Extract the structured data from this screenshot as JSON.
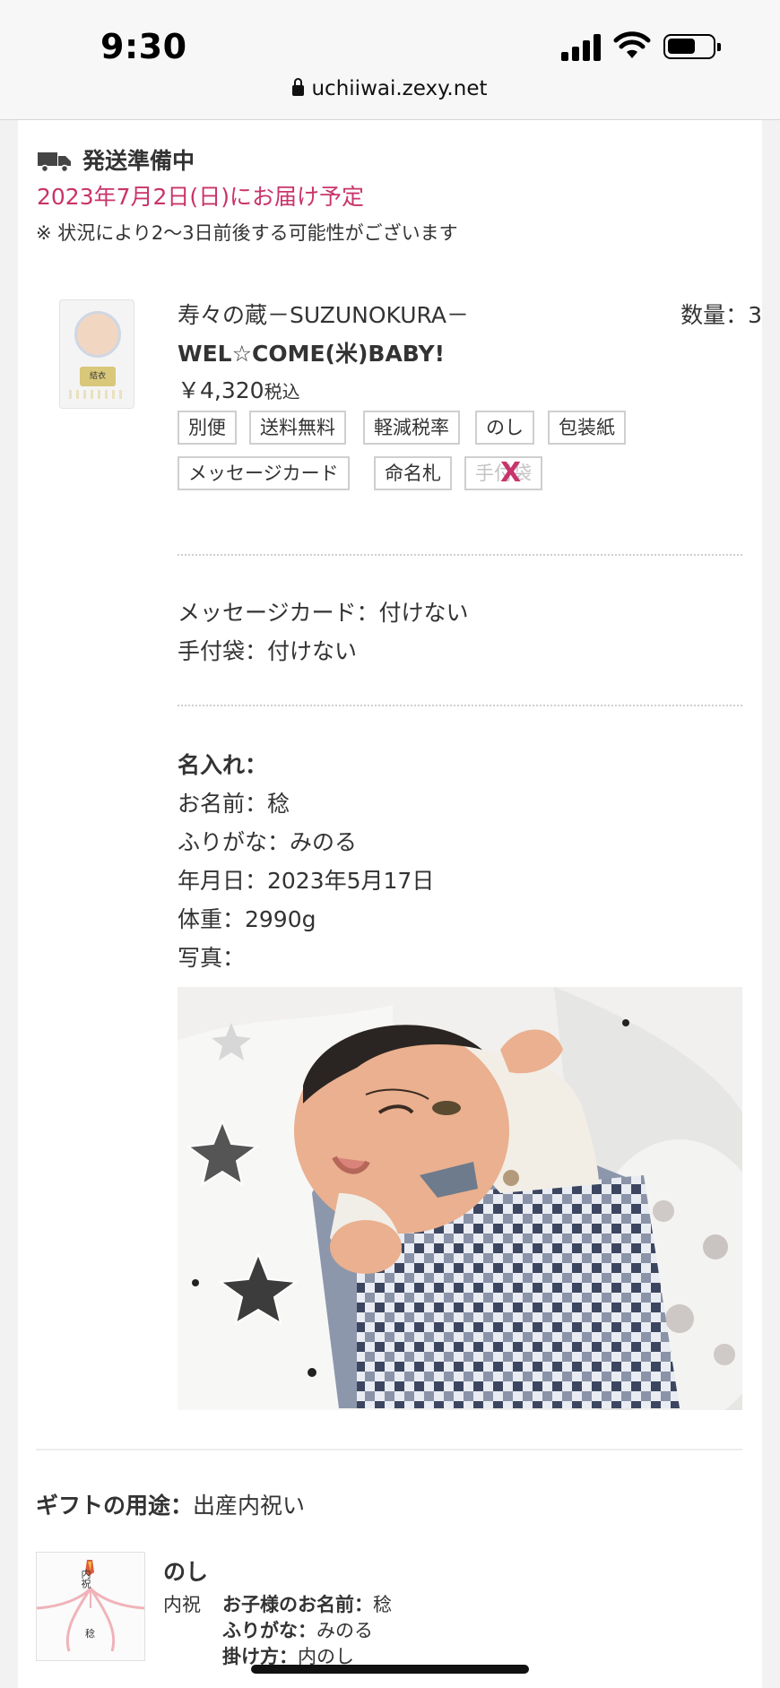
{
  "status_bar": {
    "time": "9:30"
  },
  "browser": {
    "url": "uchiiwai.zexy.net"
  },
  "shipping": {
    "status": "発送準備中",
    "delivery_date": "2023年7月2日(日)にお届け予定",
    "notice": "※ 状況により2〜3日前後する可能性がございます"
  },
  "product": {
    "brand": "寿々の蔵－SUZUNOKURA－",
    "quantity": "数量：3",
    "name": "WEL☆COME(米)BABY!",
    "price": "￥4,320",
    "tax_label": "税込",
    "thumbnail_label": "結衣",
    "tags": [
      "別便",
      "送料無料",
      "軽減税率",
      "のし",
      "包装紙",
      "メッセージカード",
      "命名札",
      "手付袋"
    ],
    "disabled_tag": "手付袋"
  },
  "options": {
    "message_card": "メッセージカード：付けない",
    "handbag": "手付袋：付けない"
  },
  "name_print": {
    "heading": "名入れ：",
    "name": "お名前：稔",
    "furigana": "ふりがな：みのる",
    "date": "年月日：2023年5月17日",
    "weight": "体重：2990g",
    "photo": "写真："
  },
  "gift": {
    "usage_label": "ギフトの用途：",
    "usage_value": "出産内祝い"
  },
  "noshi": {
    "title": "のし",
    "kind": "内祝",
    "child_name_label": "お子様のお名前：",
    "child_name_value": "稔",
    "furigana_label": "ふりがな：",
    "furigana_value": "みのる",
    "method_label": "掛け方：",
    "method_value": "内のし",
    "image_text_top": "内祝",
    "image_text_bottom": "稔"
  },
  "colors": {
    "accent": "#c9346a",
    "text": "#333333",
    "tag_border": "#cfcfcf"
  },
  "icons": [
    "lock-icon",
    "truck-icon",
    "signal-icon",
    "wifi-icon",
    "battery-icon",
    "cross-mark-icon"
  ]
}
